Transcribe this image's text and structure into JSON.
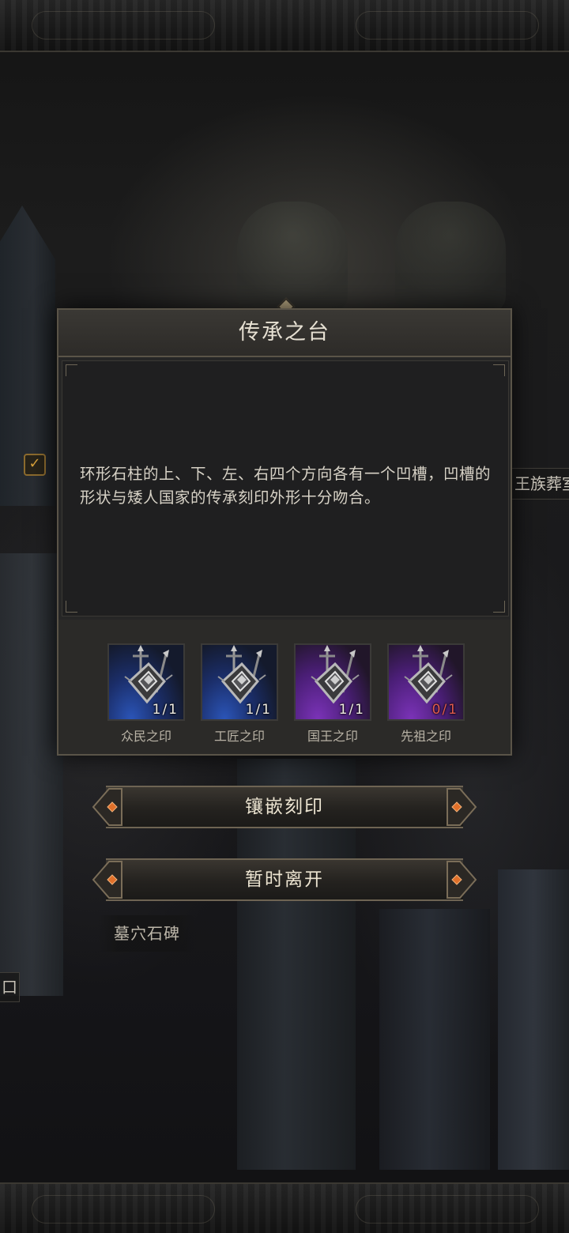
{
  "dialog": {
    "title": "传承之台",
    "description": "环形石柱的上、下、左、右四个方向各有一个凹槽，凹槽的形状与矮人国家的传承刻印外形十分吻合。",
    "seals": [
      {
        "name": "众民之印",
        "count": "1/1",
        "rarity": "blue",
        "owned": 1,
        "required": 1
      },
      {
        "name": "工匠之印",
        "count": "1/1",
        "rarity": "blue",
        "owned": 1,
        "required": 1
      },
      {
        "name": "国王之印",
        "count": "1/1",
        "rarity": "purple",
        "owned": 1,
        "required": 1
      },
      {
        "name": "先祖之印",
        "count": "0/1",
        "rarity": "purple",
        "owned": 0,
        "required": 1
      }
    ]
  },
  "buttons": {
    "embed_label": "镶嵌刻印",
    "leave_label": "暂时离开"
  },
  "scene": {
    "tomb_label": "墓穴石碑",
    "right_label_partial": "王族葬室",
    "left_label_partial": "口",
    "checkbox_mark": "✓"
  },
  "colors": {
    "accent_gold": "#d9a13a",
    "lacking_red": "#e05a4e",
    "blue_rarity": "#2b55b8",
    "purple_rarity": "#7b33b8"
  }
}
